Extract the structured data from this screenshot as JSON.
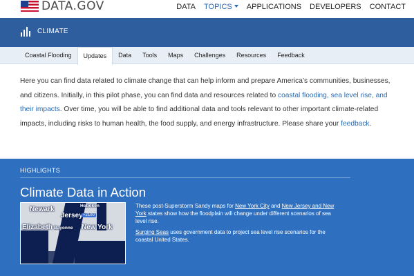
{
  "header": {
    "logo_text": "DATA.GOV",
    "nav": [
      "DATA",
      "TOPICS",
      "APPLICATIONS",
      "DEVELOPERS",
      "CONTACT"
    ]
  },
  "banner": {
    "title": "CLIMATE",
    "icon": "bar-chart-icon"
  },
  "subnav": {
    "items": [
      "Coastal Flooding",
      "Updates",
      "Data",
      "Tools",
      "Maps",
      "Challenges",
      "Resources",
      "Feedback"
    ],
    "active": "Updates"
  },
  "intro": {
    "part1": "Here you can find data related to climate change that can help inform and prepare America’s communities, businesses, and citizens. Initially, in this pilot phase, you can find data and resources related to ",
    "link1": "coastal flooding, sea level rise, and their impacts",
    "part2": ". Over time, you will be able to find additional data and tools relevant to other important climate-related impacts, including risks to human health, the food supply, and energy infrastructure. Please share your ",
    "link2": "feedback",
    "part3": "."
  },
  "highlights": {
    "label": "HIGHLIGHTS",
    "title": "Climate Data in Action",
    "map_labels": {
      "newark": "Newark",
      "jersey": "Jersey",
      "hoboken": "Hoboken",
      "elizabeth": "Elizabeth",
      "bayonne": "Bayonne",
      "new_york": "New York",
      "badge": "+2100"
    },
    "p1_a": "These post-Superstorm Sandy maps for ",
    "p1_link1": "New York City",
    "p1_b": " and ",
    "p1_link2": "New Jersey and New York",
    "p1_c": " states show how the floodplain will change under different scenarios of sea level rise.",
    "p2_link": "Surging Seas",
    "p2_b": " uses government data to project sea level rise scenarios for the coastal United States."
  },
  "colors": {
    "banner": "#2e5e9e",
    "highlights": "#2e6fbf",
    "link": "#2a6ab1"
  }
}
